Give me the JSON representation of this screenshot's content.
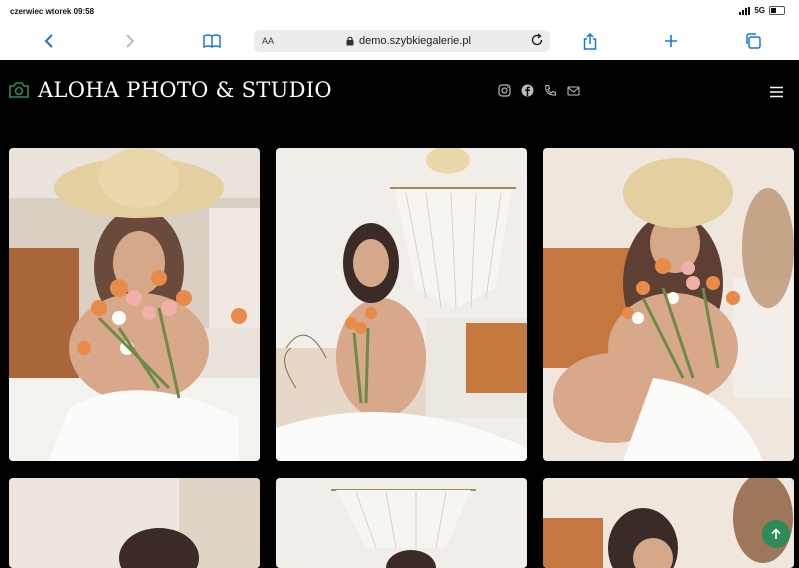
{
  "status_bar": {
    "time": "czerwiec wtorek 09:58",
    "network": "5G"
  },
  "browser": {
    "text_size_label": "AA",
    "address": "demo.szybkiegalerie.pl",
    "icons": [
      "back-icon",
      "forward-icon",
      "bookmarks-icon",
      "lock-icon",
      "reload-icon",
      "share-icon",
      "new-tab-icon",
      "tabs-icon"
    ]
  },
  "site": {
    "brand": "ALOHA PHOTO & STUDIO",
    "logo_icon": "camera-icon",
    "social_icons": [
      "instagram-icon",
      "facebook-icon",
      "phone-icon",
      "email-icon"
    ],
    "menu_icon": "hamburger-menu-icon"
  },
  "gallery": {
    "photos": [
      {
        "subject": "woman in straw hat holding tulips"
      },
      {
        "subject": "woman smiling sitting with tulips by macrame"
      },
      {
        "subject": "woman in straw hat laughing with tulips"
      },
      {
        "subject": "woman by macrame wall"
      },
      {
        "subject": "macrame wall hanging"
      },
      {
        "subject": "woman with dried flowers"
      }
    ]
  },
  "colors": {
    "accent": "#2e8b57",
    "link": "#1a73e8",
    "background": "#000000"
  },
  "scroll_to_top_icon": "arrow-up-icon"
}
